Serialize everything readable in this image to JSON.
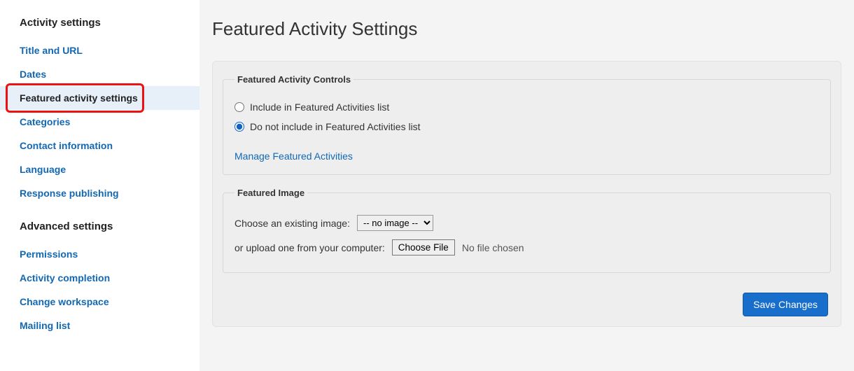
{
  "sidebar": {
    "section1_title": "Activity settings",
    "section2_title": "Advanced settings",
    "items1": [
      {
        "label": "Title and URL"
      },
      {
        "label": "Dates"
      },
      {
        "label": "Featured activity settings"
      },
      {
        "label": "Categories"
      },
      {
        "label": "Contact information"
      },
      {
        "label": "Language"
      },
      {
        "label": "Response publishing"
      }
    ],
    "items2": [
      {
        "label": "Permissions"
      },
      {
        "label": "Activity completion"
      },
      {
        "label": "Change workspace"
      },
      {
        "label": "Mailing list"
      }
    ]
  },
  "page": {
    "title": "Featured Activity Settings"
  },
  "controls": {
    "legend": "Featured Activity Controls",
    "option_include": "Include in Featured Activities list",
    "option_exclude": "Do not include in Featured Activities list",
    "manage_link": "Manage Featured Activities"
  },
  "image": {
    "legend": "Featured Image",
    "choose_label": "Choose an existing image:",
    "select_value": "-- no image --",
    "upload_label": "or upload one from your computer:",
    "choose_file_btn": "Choose File",
    "file_status": "No file chosen"
  },
  "actions": {
    "save": "Save Changes"
  }
}
